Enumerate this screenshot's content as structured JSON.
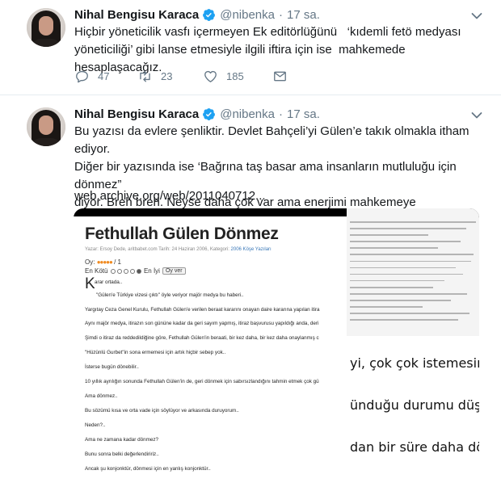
{
  "tweets": [
    {
      "name": "Nihal Bengisu Karaca",
      "handle": "@nibenka",
      "separator": "·",
      "time": "17 sa.",
      "text": "Hiçbir yöneticilik vasfı içermeyen Ek editörlüğünü   ‘kıdemli fetö medyası\nyöneticiliği’ gibi lanse etmesiyle ilgili iftira için ise  mahkemede hesaplaşacağız.",
      "actions": {
        "replies": "47",
        "retweets": "23",
        "likes": "185"
      }
    },
    {
      "name": "Nihal Bengisu Karaca",
      "handle": "@nibenka",
      "separator": "·",
      "time": "17 sa.",
      "text": "Bu yazısı da evlere şenliktir. Devlet Bahçeli’yi Gülen’e takık olmakla itham ediyor.\nDiğer bir yazısında ise ‘Bağrına taş basar ama insanların mutluluğu için dönmez”\ndiyor. Breh breh. Neyse daha çok var ama enerjimi mahkemeye saklayacağım",
      "link": "web.archive.org/web/2011040712...",
      "media": {
        "article_title": "Fethullah Gülen Dönmez",
        "article_meta": "Yazar: Ersoy Dede, aritbabet.com Tarih: 24 Haziran 2006, Kategori:",
        "article_meta_highlight": "2006 Köşe Yazıları",
        "rating_label": "Oy:",
        "rating_stars": "●●●●●",
        "rating_value": "/ 1",
        "rating_worst": "En Kötü",
        "rating_best": "En İyi",
        "rating_button": "Oy ver",
        "dropcap": "K",
        "lines": [
          "arar ortada..",
          "\"Gülen'e Türkiye vizesi çıktı\" öyle veriyor majör medya bu haberi..",
          "Yargıtay Ceza Genel Kurulu, Fethullah Gülen'e verilen beraat kararını onayan daire kararına yapılan itira",
          "Aynı majör medya, itirazın son gününe kadar da geri sayım yapmış, itiraz başvurusu yapıldığı anda, deri",
          "Şimdi o itiraz da reddedildiğine göre, Fethullah Gülen'in beraati, bir kez daha, bir kez daha onaylanmış c",
          "\"Hüzünlü Gurbet\"in sona ermemesi için artık hiçbir sebep yok..",
          "İsterse bugün dönebilir..",
          "10 yıllık ayrılığın sonunda Fethullah Gülen'in de, geri dönmek için sabırsızlandığını tahmin etmek çok gü",
          "Ama dönmez..",
          "Bu sözümü kısa ve orta vade için söylüyor ve arkasında duruyorum..",
          "Neden?..",
          "Ama ne zamana kadar dönmez?",
          "Bunu sonra belki değerlendiririz..",
          "Ancak şu konjonktür, dönmesi için en yanlış konjonktür.."
        ],
        "zoom_lines": [
          "yi, çok çok istemesine ra",
          "ünduğu durumu düşündüğ",
          "dan bir süre daha dönme"
        ]
      }
    }
  ],
  "colors": {
    "verified": "#1da1f2",
    "secondary_text": "#657786",
    "divider": "#e6ecf0"
  },
  "icons": [
    "verified-badge-icon",
    "caret-down-icon",
    "reply-icon",
    "retweet-icon",
    "like-icon",
    "direct-message-icon"
  ]
}
